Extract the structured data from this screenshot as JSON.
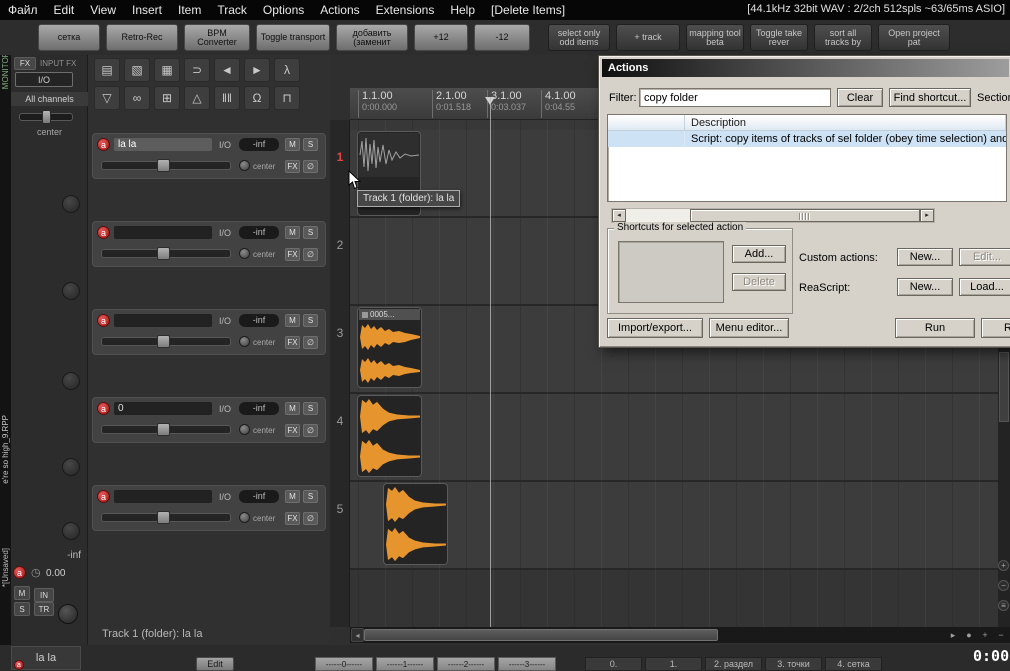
{
  "menubar": {
    "items": [
      "Файл",
      "Edit",
      "View",
      "Insert",
      "Item",
      "Track",
      "Options",
      "Actions",
      "Extensions",
      "Help",
      "[Delete Items]"
    ],
    "status": "[44.1kHz 32bit WAV : 2/2ch 512spls ~63/65ms ASIO]"
  },
  "toolbar": {
    "buttons": [
      "сетка",
      "Retro-Rec",
      "BPM Converter",
      "Toggle transport",
      "добавить (заменит",
      "+12",
      "-12",
      "select only odd items",
      "+ track",
      "mapping tool beta",
      "Toggle take rever",
      "sort all tracks by",
      "Open project pat"
    ]
  },
  "left_strip": {
    "monitor_label": "MONITOR FX: I/O",
    "project_name": "e're so high_9.RPP",
    "unsaved": "*[Unsaved]"
  },
  "master": {
    "fx": "FX",
    "input_fx": "INPUT FX",
    "io": "I/O",
    "all_channels": "All channels",
    "center_label": "center",
    "volume": "-inf",
    "gain": "0.00",
    "mute": "M",
    "solo": "S",
    "input": "IN",
    "track_btn": "TR",
    "tab_name": "la la"
  },
  "icons": {
    "record_arm": "a",
    "new_doc": "▤",
    "open_doc": "▧",
    "save": "▦",
    "attach": "⊃",
    "nav_prev": "◄",
    "nav_next": "►",
    "lambda": "λ",
    "filter": "▽",
    "link": "∞",
    "grid": "⊞",
    "metronome": "△",
    "ripple": "‖‖",
    "omega": "Ω",
    "lock": "⊓",
    "clock": "◷",
    "phase": "∅",
    "scroll_left": "◂",
    "scroll_right": "▸",
    "pan_dot": "●",
    "zoom_in": "+",
    "zoom_out": "−",
    "zoom_menu": "≡"
  },
  "track_labels": {
    "io": "I/O",
    "volume": "-inf",
    "mute": "M",
    "solo": "S",
    "fx": "FX",
    "center": "center"
  },
  "tracks": [
    {
      "num": "1",
      "name": "la la"
    },
    {
      "num": "2",
      "name": ""
    },
    {
      "num": "3",
      "name": ""
    },
    {
      "num": "4",
      "name": "0"
    },
    {
      "num": "5",
      "name": ""
    }
  ],
  "ruler": [
    {
      "beat": "1.1.00",
      "time": "0:00.000"
    },
    {
      "beat": "2.1.00",
      "time": "0:01.518"
    },
    {
      "beat": "3.1.00",
      "time": "0:03.037"
    },
    {
      "beat": "4.1.00",
      "time": "0:04.55"
    }
  ],
  "arrange": {
    "item3_label": "0005...",
    "tooltip": "Track 1 (folder): la la"
  },
  "status_bar": {
    "track_info": "Track 1 (folder): la la"
  },
  "actions_dialog": {
    "title": "Actions",
    "filter_label": "Filter:",
    "filter_value": "copy folder",
    "clear_btn": "Clear",
    "find_shortcut_btn": "Find shortcut...",
    "section_label": "Section:",
    "col_description": "Description",
    "result_row": "Script: copy items of tracks of sel folder (obey time selection) and paste",
    "shortcuts_group": "Shortcuts for selected action",
    "add_btn": "Add...",
    "delete_btn": "Delete",
    "custom_actions_label": "Custom actions:",
    "custom_new_btn": "New...",
    "custom_edit_btn": "Edit...",
    "reascript_label": "ReaScript:",
    "reascript_new_btn": "New...",
    "reascript_load_btn": "Load...",
    "import_export_btn": "Import/export...",
    "menu_editor_btn": "Menu editor...",
    "run_btn": "Run",
    "run_close_btn": "Ru"
  },
  "bottom_bar": {
    "edit_btn": "Edit",
    "measure_tabs": [
      "------0------",
      "------1------",
      "------2------",
      "------3------"
    ],
    "mode_tabs": [
      "0.",
      "1.",
      "2. раздел",
      "3. точки",
      "4. сетка"
    ],
    "time_display": "0:00"
  }
}
